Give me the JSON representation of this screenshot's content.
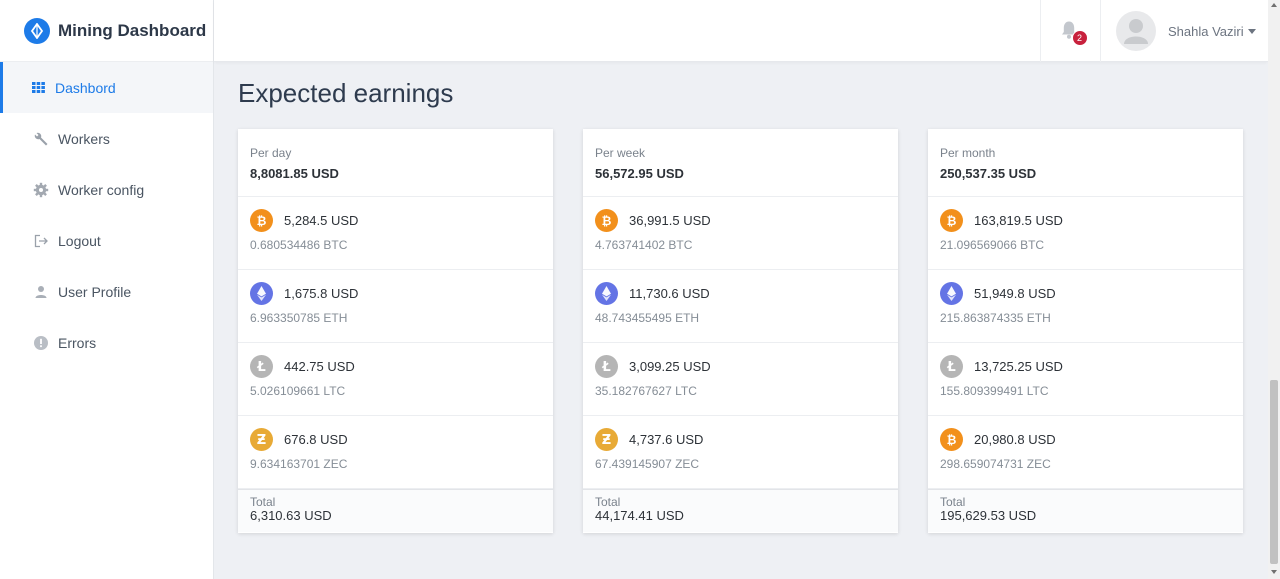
{
  "brand": {
    "title": "Mining Dashboard",
    "color": "#1d7be8"
  },
  "sidebar": {
    "items": [
      {
        "label": "Dashbord",
        "icon": "grid-icon",
        "active": true
      },
      {
        "label": "Workers",
        "icon": "wrench-icon"
      },
      {
        "label": "Worker config",
        "icon": "gear-icon"
      },
      {
        "label": "Logout",
        "icon": "logout-icon"
      },
      {
        "label": "User Profile",
        "icon": "user-icon"
      },
      {
        "label": "Errors",
        "icon": "alert-icon"
      }
    ]
  },
  "header": {
    "notifications_count": "2",
    "user_name": "Shahla Vaziri"
  },
  "main": {
    "title": "Expected earnings",
    "cards": [
      {
        "period": "Per day",
        "header_total": "8,8081.85 USD",
        "rows": [
          {
            "coin": "bitcoin",
            "usd": "5,284.5 USD",
            "crypto": "0.680534486 BTC"
          },
          {
            "coin": "ethereum",
            "usd": "1,675.8 USD",
            "crypto": "6.963350785 ETH"
          },
          {
            "coin": "litecoin",
            "usd": "442.75 USD",
            "crypto": "5.026109661 LTC"
          },
          {
            "coin": "zcash",
            "usd": "676.8 USD",
            "crypto": "9.634163701 ZEC"
          }
        ],
        "footer_label": "Total",
        "footer_value": "6,310.63 USD"
      },
      {
        "period": "Per week",
        "header_total": "56,572.95 USD",
        "rows": [
          {
            "coin": "bitcoin",
            "usd": "36,991.5 USD",
            "crypto": "4.763741402 BTC"
          },
          {
            "coin": "ethereum",
            "usd": "11,730.6 USD",
            "crypto": "48.743455495 ETH"
          },
          {
            "coin": "litecoin",
            "usd": "3,099.25 USD",
            "crypto": "35.182767627 LTC"
          },
          {
            "coin": "zcash",
            "usd": "4,737.6 USD",
            "crypto": "67.439145907 ZEC"
          }
        ],
        "footer_label": "Total",
        "footer_value": "44,174.41 USD"
      },
      {
        "period": "Per month",
        "header_total": "250,537.35 USD",
        "rows": [
          {
            "coin": "bitcoin",
            "usd": "163,819.5 USD",
            "crypto": "21.096569066 BTC"
          },
          {
            "coin": "ethereum",
            "usd": "51,949.8 USD",
            "crypto": "215.863874335 ETH"
          },
          {
            "coin": "litecoin",
            "usd": "13,725.25 USD",
            "crypto": "155.809399491 LTC"
          },
          {
            "coin": "bitcoin",
            "usd": "20,980.8 USD",
            "crypto": "298.659074731 ZEC"
          }
        ],
        "footer_label": "Total",
        "footer_value": "195,629.53 USD"
      }
    ]
  },
  "colors": {
    "accent": "#1d7be8",
    "badge": "#c8213d",
    "bitcoin": "#f2901c",
    "ethereum": "#6474e5",
    "litecoin": "#b5b5b5",
    "zcash": "#e8aa36"
  }
}
